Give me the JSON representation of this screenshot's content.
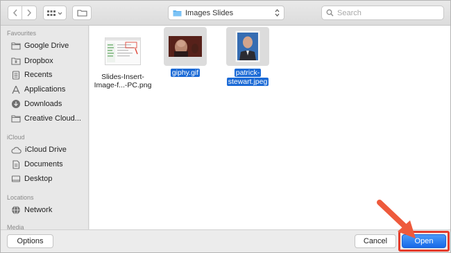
{
  "toolbar": {
    "back_icon": "chevron-left-icon",
    "forward_icon": "chevron-right-icon",
    "view_icon": "icon-grid-view-icon",
    "group_icon": "folder-icon",
    "location": {
      "label": "Images Slides",
      "icon": "folder-icon"
    },
    "search": {
      "placeholder": "Search"
    }
  },
  "sidebar": {
    "sections": {
      "favourites": "Favourites",
      "icloud": "iCloud",
      "locations": "Locations",
      "media": "Media"
    },
    "favourites": [
      {
        "label": "Google Drive",
        "icon": "folder-icon"
      },
      {
        "label": "Dropbox",
        "icon": "dropbox-icon"
      },
      {
        "label": "Recents",
        "icon": "recents-icon"
      },
      {
        "label": "Applications",
        "icon": "applications-icon"
      },
      {
        "label": "Downloads",
        "icon": "downloads-icon"
      },
      {
        "label": "Creative Cloud...",
        "icon": "folder-icon"
      }
    ],
    "icloud": [
      {
        "label": "iCloud Drive",
        "icon": "cloud-icon"
      },
      {
        "label": "Documents",
        "icon": "document-icon"
      },
      {
        "label": "Desktop",
        "icon": "desktop-icon"
      }
    ],
    "locations": [
      {
        "label": "Network",
        "icon": "globe-icon"
      }
    ]
  },
  "files": [
    {
      "name_line1": "Slides-Insert-",
      "name_line2": "Image-f...-PC.png",
      "selected": false
    },
    {
      "name_line1": "giphy.gif",
      "name_line2": "",
      "selected": true
    },
    {
      "name_line1": "patrick-",
      "name_line2": "stewart.jpeg",
      "selected": true
    }
  ],
  "buttons": {
    "options": "Options",
    "cancel": "Cancel",
    "open": "Open"
  },
  "colors": {
    "accent": "#1b6ad6",
    "highlight_outline": "#e53b2b",
    "arrow": "#ee5a3c"
  }
}
